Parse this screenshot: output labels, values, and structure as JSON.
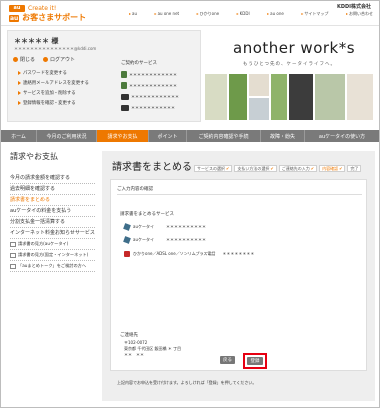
{
  "header": {
    "logo_badge": "au",
    "logo_tagline": "Create it!",
    "logo_main_a": "au",
    "logo_main_b": "お客さまサポート",
    "corp_logo": "KDDI株式会社",
    "top_links": [
      "au",
      "au one net",
      "ひかりone",
      "KDDI",
      "au one",
      "サイトマップ",
      "お問い合わせ"
    ]
  },
  "account": {
    "name": "＊＊＊＊＊ 様",
    "id_masked": "＊＊＊＊＊＊＊＊＊＊＊＊＊＊＊＊＊",
    "email_masked": "＊＊＊＊＊＊＊＊＊＊＊＊＊＊＊@kddi.com",
    "links": [
      "閉じる",
      "ログアウト"
    ],
    "menu": [
      "パスワードを変更する",
      "連絡用メールアドレスを変更する",
      "サービスを追加・削除する",
      "登録情報を確認・変更する"
    ],
    "services_label": "ご契約のサービス",
    "services": [
      "＊＊＊＊＊＊＊＊＊＊＊＊",
      "＊＊＊＊＊＊＊＊＊＊＊＊",
      "＊＊＊＊＊＊＊＊＊＊＊＊",
      "＊＊＊＊＊＊＊＊＊＊＊"
    ]
  },
  "banner": {
    "title": "another work*s",
    "subtitle": "もうひとつ先の、ケータイライフへ。"
  },
  "navbar": {
    "items": [
      "ホーム",
      "今月のご利用状況",
      "請求やお支払",
      "ポイント",
      "ご契約内容確認や手続",
      "故障・紛失",
      "auケータイの使い方"
    ],
    "active_index": 2
  },
  "sidebar": {
    "title": "請求やお支払",
    "items": [
      "今月の請求金額を確認する",
      "過去明細を確認する",
      "請求書をまとめる",
      "auケータイの料金を支払う",
      "分割支払金一括清算する",
      "インターネット料金お知らせサービス"
    ],
    "current_index": 2,
    "small_items": [
      "請求書の見方(auケータイ)",
      "請求書の見方(固定・インターネット)",
      "「auまとめトーク」をご検討の方へ"
    ]
  },
  "main": {
    "title": "請求書をまとめる",
    "steps": [
      {
        "label": "サービスの選択",
        "done": true
      },
      {
        "label": "支払い方法の選択",
        "done": true
      },
      {
        "label": "ご連絡先の入力",
        "done": true
      },
      {
        "label": "内容確認",
        "done": true
      },
      {
        "label": "完了",
        "done": false
      }
    ],
    "current_step_index": 3,
    "section_heading": "ご入力内容の確認",
    "summary_label": "請求書をまとめるサービス",
    "summary_rows": [
      {
        "service": "auケータイ",
        "value": "＊＊＊＊＊＊＊＊＊＊"
      },
      {
        "service": "auケータイ",
        "value": "＊＊＊＊＊＊＊＊＊＊"
      },
      {
        "service": "ひかりone／ADSL one／ソンリムプラス電話",
        "value": "＊＊＊＊＊＊＊＊"
      }
    ],
    "dest_label": "ご連絡先",
    "dest_lines": [
      "〒102-0072",
      "東京都 千代田区 飯田橋 ＊ 丁目",
      "＊＊　＊＊"
    ],
    "back_label": "戻る",
    "register_label": "登録",
    "note": "上記内容でお申込を受け付けます。よろしければ「登録」を押してください。"
  },
  "colors": {
    "accent": "#ee7800",
    "nav_bg": "#7a7a7a",
    "highlight": "#e60012"
  }
}
